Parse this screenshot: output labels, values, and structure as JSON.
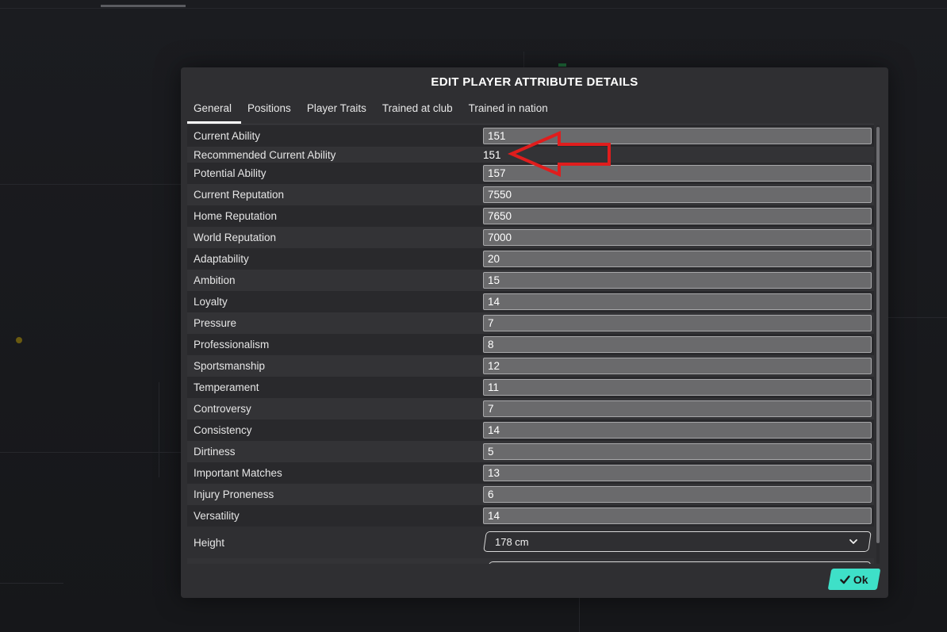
{
  "dialog": {
    "title": "EDIT PLAYER ATTRIBUTE DETAILS",
    "tabs": [
      {
        "label": "General",
        "active": true
      },
      {
        "label": "Positions",
        "active": false
      },
      {
        "label": "Player Traits",
        "active": false
      },
      {
        "label": "Trained at club",
        "active": false
      },
      {
        "label": "Trained in nation",
        "active": false
      }
    ],
    "attributes": [
      {
        "label": "Current Ability",
        "value": "151",
        "editable": true
      },
      {
        "label": "Recommended Current Ability",
        "value": "151",
        "editable": false
      },
      {
        "label": "Potential Ability",
        "value": "157",
        "editable": true
      },
      {
        "label": "Current Reputation",
        "value": "7550",
        "editable": true
      },
      {
        "label": "Home Reputation",
        "value": "7650",
        "editable": true
      },
      {
        "label": "World Reputation",
        "value": "7000",
        "editable": true
      },
      {
        "label": "Adaptability",
        "value": "20",
        "editable": true
      },
      {
        "label": "Ambition",
        "value": "15",
        "editable": true
      },
      {
        "label": "Loyalty",
        "value": "14",
        "editable": true
      },
      {
        "label": "Pressure",
        "value": "7",
        "editable": true
      },
      {
        "label": "Professionalism",
        "value": "8",
        "editable": true
      },
      {
        "label": "Sportsmanship",
        "value": "12",
        "editable": true
      },
      {
        "label": "Temperament",
        "value": "11",
        "editable": true
      },
      {
        "label": "Controversy",
        "value": "7",
        "editable": true
      },
      {
        "label": "Consistency",
        "value": "14",
        "editable": true
      },
      {
        "label": "Dirtiness",
        "value": "5",
        "editable": true
      },
      {
        "label": "Important Matches",
        "value": "13",
        "editable": true
      },
      {
        "label": "Injury Proneness",
        "value": "6",
        "editable": true
      },
      {
        "label": "Versatility",
        "value": "14",
        "editable": true
      }
    ],
    "height": {
      "label": "Height",
      "value": "178 cm"
    },
    "ok_label": "Ok"
  },
  "icons": {
    "ok": "checkmark-icon",
    "height_select": "chevron-down-icon",
    "annotation": "red-arrow-left-icon"
  },
  "colors": {
    "accent": "#3ee0c8",
    "annotation": "#e01d1d",
    "modal_bg": "#2f2f32",
    "input_bg": "#6a6a6c"
  }
}
